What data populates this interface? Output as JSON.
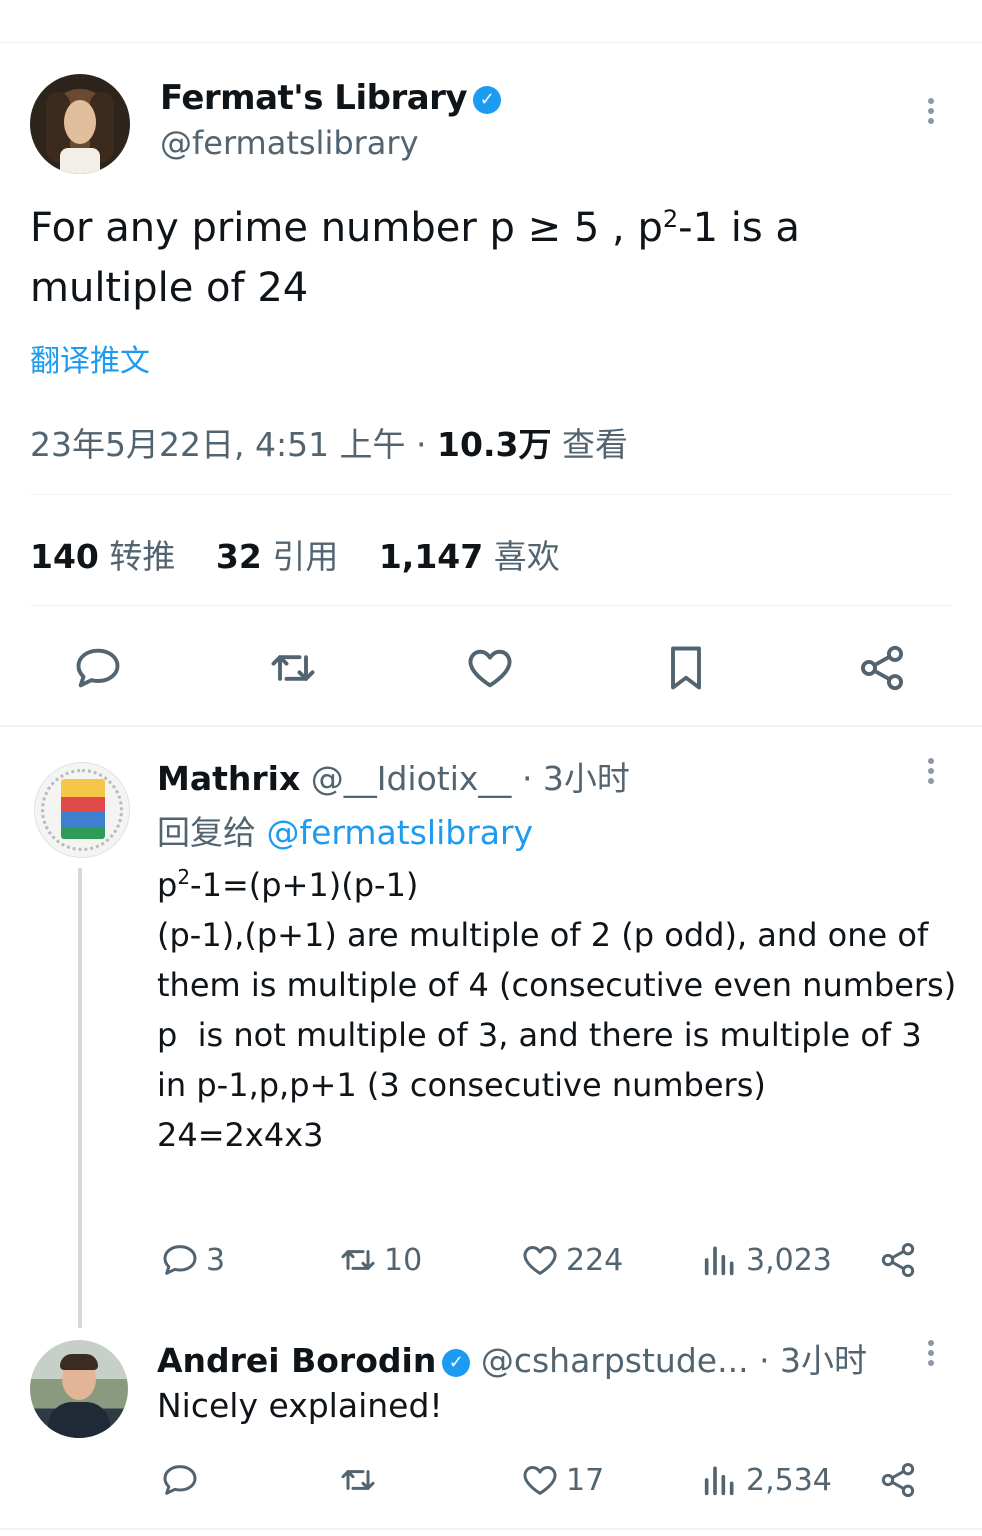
{
  "colors": {
    "accent": "#1d9bf0",
    "text_primary": "#0f1419",
    "text_secondary": "#536471",
    "divider": "#eff3f4"
  },
  "tweet": {
    "author_name": "Fermat's Library",
    "author_handle": "@fermatslibrary",
    "verified_icon": "verified-badge-icon",
    "text_part1": "For any prime number p ≥ 5 , p",
    "text_sup": "2",
    "text_part2": "-1 is a multiple of 24",
    "translate_label": "翻译推文",
    "timestamp": "23年5月22日, 4:51 上午 · ",
    "views_count": "10.3万",
    "views_label": "查看",
    "stats": {
      "retweets_count": "140",
      "retweets_label": "转推",
      "quotes_count": "32",
      "quotes_label": "引用",
      "likes_count": "1,147",
      "likes_label": "喜欢"
    },
    "actions": [
      "reply-icon",
      "retweet-icon",
      "like-icon",
      "bookmark-icon",
      "share-icon"
    ]
  },
  "replies": [
    {
      "name": "Mathrix",
      "handle": "@__Idiotix__",
      "time": "· 3小时",
      "reply_to_label": "回复给",
      "reply_to_handle": "@fermatslibrary",
      "line1_a": "p",
      "line1_sup": "2",
      "line1_b": "-1=(p+1)(p-1)",
      "line2": "(p-1),(p+1) are multiple of 2 (p odd), and one of them is multiple of 4 (consecutive even numbers)",
      "line3": "p  is not multiple of 3, and there is multiple of 3 in p-1,p,p+1 (3 consecutive numbers)",
      "line4": "24=2x4x3",
      "replies_count": "3",
      "retweets_count": "10",
      "likes_count": "224",
      "views_count": "3,023"
    },
    {
      "name": "Andrei Borodin",
      "handle": "@csharpstude...",
      "time": "· 3小时",
      "text": "Nicely explained!",
      "likes_count": "17",
      "views_count": "2,534"
    }
  ]
}
